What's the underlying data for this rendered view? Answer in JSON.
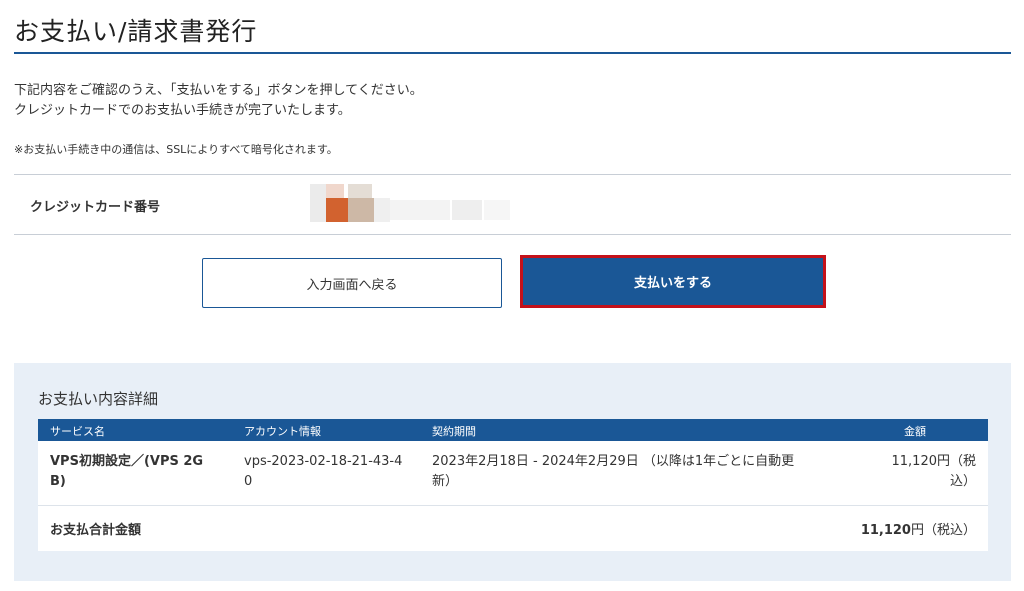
{
  "page": {
    "title": "お支払い/請求書発行"
  },
  "intro": {
    "line1": "下記内容をご確認のうえ、「支払いをする」ボタンを押してください。",
    "line2": "クレジットカードでのお支払い手続きが完了いたします。",
    "ssl_note": "※お支払い手続き中の通信は、SSLによりすべて暗号化されます。"
  },
  "card": {
    "label": "クレジットカード番号"
  },
  "buttons": {
    "back_label": "入力画面へ戻る",
    "pay_label": "支払いをする"
  },
  "colors": {
    "brand_blue": "#1a5796",
    "highlight_red": "#c4111a",
    "panel_bg": "#e8eff7"
  },
  "details": {
    "title": "お支払い内容詳細",
    "headers": {
      "service": "サービス名",
      "account": "アカウント情報",
      "period": "契約期間",
      "amount": "金額"
    },
    "row": {
      "service_line1": "VPS初期設定／(VPS 2G",
      "service_line2": "B)",
      "account_line1": "vps-2023-02-18-21-43-4",
      "account_line2": "0",
      "period_line1": "2023年2月18日 - 2024年2月29日 （以降は1年ごとに自動更",
      "period_line2": "新）",
      "amount_line1": "11,120円（税",
      "amount_line2": "込）"
    },
    "total": {
      "label": "お支払合計金額",
      "amount": "11,120",
      "unit": "円（税込）"
    }
  }
}
